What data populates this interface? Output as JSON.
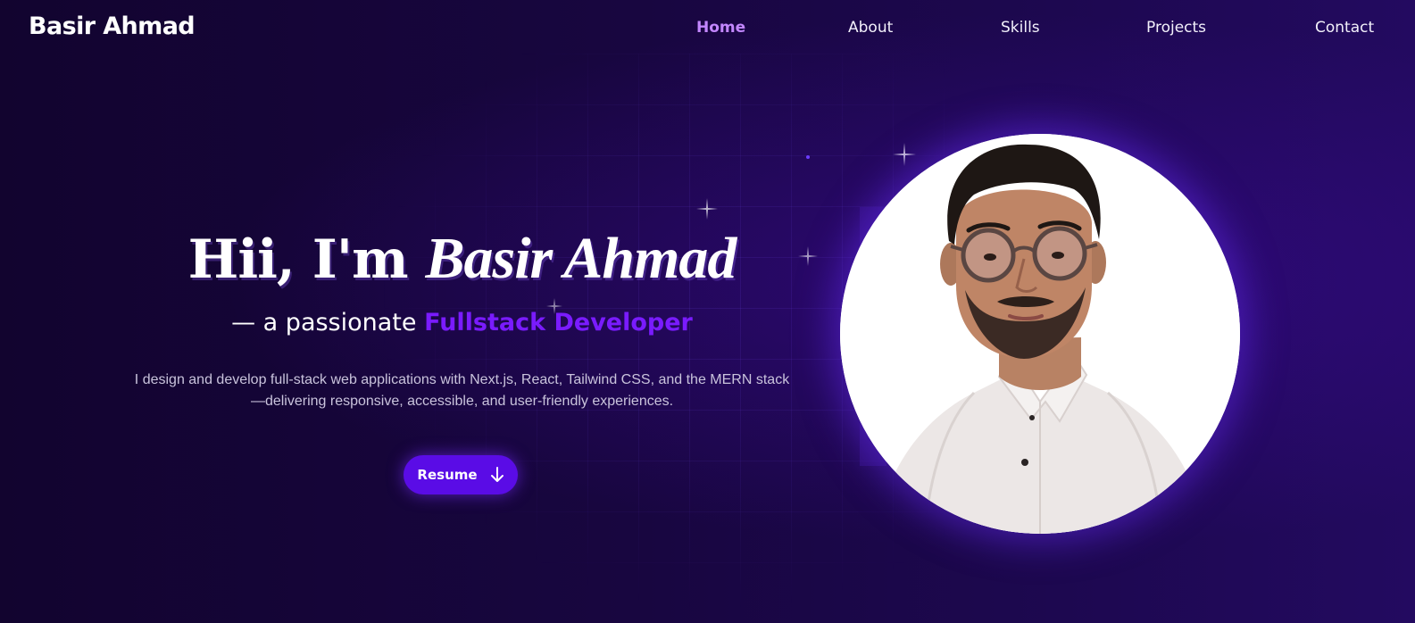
{
  "nav": {
    "brand": "Basir Ahmad",
    "links": [
      {
        "label": "Home",
        "active": true
      },
      {
        "label": "About",
        "active": false
      },
      {
        "label": "Skills",
        "active": false
      },
      {
        "label": "Projects",
        "active": false
      },
      {
        "label": "Contact",
        "active": false
      }
    ]
  },
  "hero": {
    "greeting": "Hii, I'm",
    "name": "Basir Ahmad",
    "subtitle_prefix": "— a passionate",
    "role": "Fullstack Developer",
    "description_line1": "I design and develop full-stack web applications with Next.js, React, Tailwind CSS, and the MERN stack",
    "description_line2": "—delivering responsive, accessible, and user-friendly experiences.",
    "resume_label": "Resume",
    "resume_icon": "arrow-down-icon"
  },
  "profile": {
    "image": "profile-photo"
  },
  "colors": {
    "accent": "#7a1bff",
    "nav_active": "#c387ff",
    "button": "#5a0ce6",
    "background": "#170540"
  }
}
